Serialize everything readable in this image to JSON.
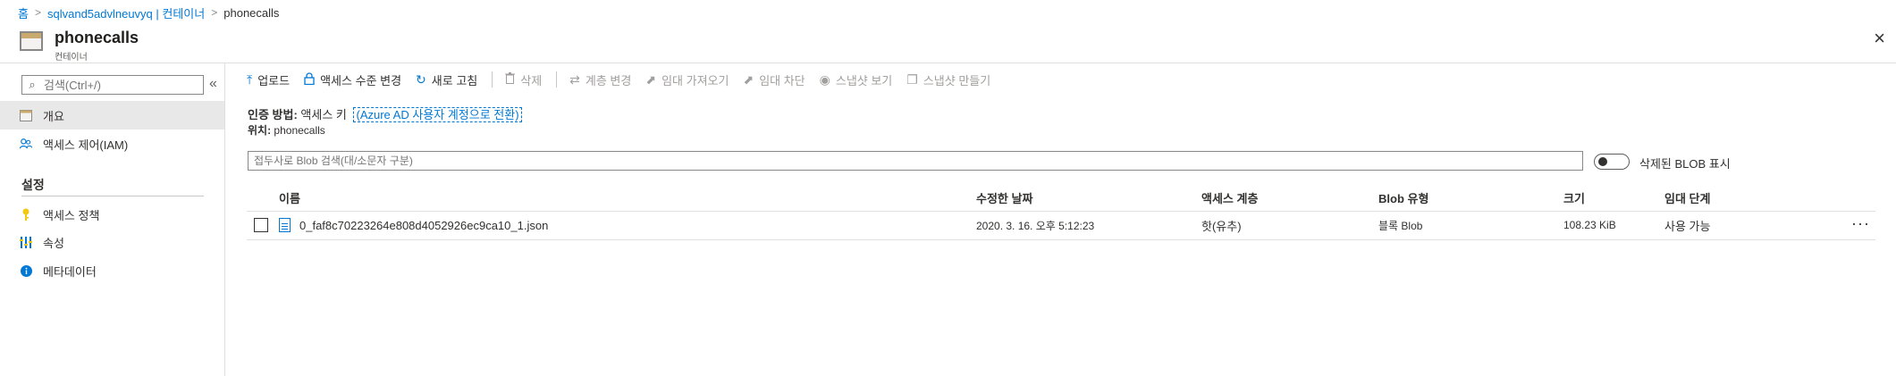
{
  "breadcrumb": {
    "home": "홈",
    "account": "sqlvand5advlneuvyq | 컨테이너",
    "current": "phonecalls"
  },
  "header": {
    "title": "phonecalls",
    "subtitle": "컨테이너",
    "close_icon": "×"
  },
  "sidebar": {
    "search_placeholder": "검색(Ctrl+/)",
    "collapse_icon": "«",
    "items": [
      {
        "label": "개요",
        "icon": "overview-icon"
      },
      {
        "label": "액세스 제어(IAM)",
        "icon": "people-icon"
      }
    ],
    "section_label": "설정",
    "settings_items": [
      {
        "label": "액세스 정책",
        "icon": "key-icon"
      },
      {
        "label": "속성",
        "icon": "properties-icon"
      },
      {
        "label": "메타데이터",
        "icon": "info-icon"
      }
    ]
  },
  "toolbar": {
    "upload": "업로드",
    "access_level": "액세스 수준 변경",
    "refresh": "새로 고침",
    "delete": "삭제",
    "change_tier": "계층 변경",
    "acquire_lease": "임대 가져오기",
    "break_lease": "임대 차단",
    "view_snapshots": "스냅샷 보기",
    "create_snapshot": "스냅샷 만들기"
  },
  "auth": {
    "label": "인증 방법:",
    "value": "액세스 키",
    "switch_link": "(Azure AD 사용자 계정으로 전환)"
  },
  "location": {
    "label": "위치:",
    "value": "phonecalls"
  },
  "blob_search": {
    "placeholder": "접두사로 Blob 검색(대/소문자 구분)"
  },
  "show_deleted": {
    "label": "삭제된 BLOB 표시"
  },
  "table": {
    "columns": [
      "이름",
      "수정한 날짜",
      "액세스 계층",
      "Blob 유형",
      "크기",
      "임대 단계"
    ],
    "rows": [
      {
        "name": "0_faf8c70223264e808d4052926ec9ca10_1.json",
        "modified": "2020. 3. 16. 오후 5:12:23",
        "tier": "핫(유추)",
        "blob_type": "블록 Blob",
        "size": "108.23 KiB",
        "lease": "사용 가능"
      }
    ],
    "more_icon": "···"
  }
}
